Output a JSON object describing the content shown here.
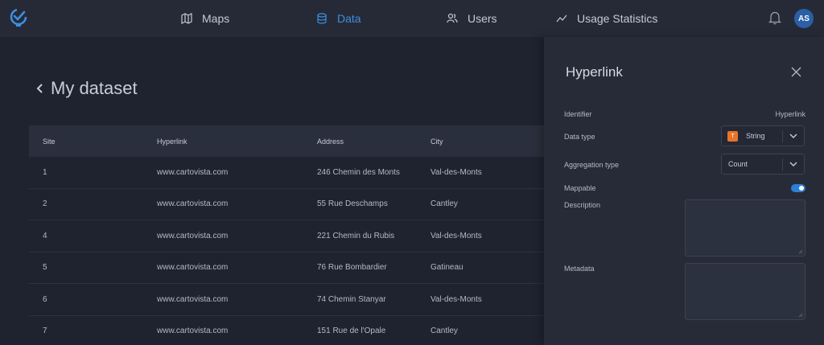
{
  "nav": {
    "items": [
      {
        "label": "Maps",
        "icon": "map-icon"
      },
      {
        "label": "Data",
        "icon": "database-icon",
        "active": true
      },
      {
        "label": "Users",
        "icon": "users-icon"
      },
      {
        "label": "Usage Statistics",
        "icon": "chart-line-icon"
      }
    ],
    "avatar_initials": "AS"
  },
  "page": {
    "title": "My dataset"
  },
  "table": {
    "headers": [
      "Site",
      "Hyperlink",
      "Address",
      "City"
    ],
    "rows": [
      [
        "1",
        "www.cartovista.com",
        "246 Chemin des Monts",
        "Val-des-Monts"
      ],
      [
        "2",
        "www.cartovista.com",
        "55 Rue Deschamps",
        "Cantley"
      ],
      [
        "4",
        "www.cartovista.com",
        "221 Chemin du Rubis",
        "Val-des-Monts"
      ],
      [
        "5",
        "www.cartovista.com",
        "76 Rue Bombardier",
        "Gatineau"
      ],
      [
        "6",
        "www.cartovista.com",
        "74 Chemin Stanyar",
        "Val-des-Monts"
      ],
      [
        "7",
        "www.cartovista.com",
        "151 Rue de l'Opale",
        "Cantley"
      ]
    ]
  },
  "panel": {
    "title": "Hyperlink",
    "identifier_label": "Identifier",
    "identifier_value": "Hyperlink",
    "data_type_label": "Data type",
    "data_type_value": "String",
    "data_type_badge": "T",
    "aggregation_label": "Aggregation type",
    "aggregation_value": "Count",
    "mappable_label": "Mappable",
    "mappable_on": true,
    "description_label": "Description",
    "metadata_label": "Metadata"
  },
  "colors": {
    "accent": "#3d8fe0",
    "string_badge": "#e8742a",
    "avatar": "#2b5fa8"
  }
}
